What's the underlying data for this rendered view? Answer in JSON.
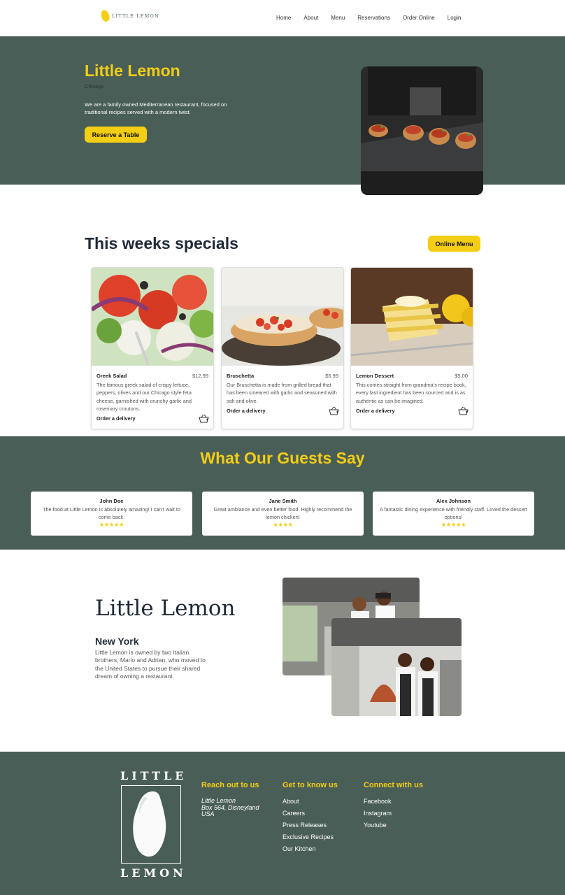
{
  "brand": {
    "logo_text": "LITTLE LEMON",
    "accent": "#F4CE14",
    "primary": "#495E57"
  },
  "nav": {
    "links": [
      "Home",
      "About",
      "Menu",
      "Reservations",
      "Order Online",
      "Login"
    ]
  },
  "hero": {
    "title": "Little Lemon",
    "city": "Chicago",
    "description": "We are a family owned Mediterranean restaurant, focused on traditional recipes served with a modern twist.",
    "cta": "Reserve a Table"
  },
  "specials": {
    "title": "This weeks specials",
    "menu_button": "Online Menu",
    "items": [
      {
        "name": "Greek Salad",
        "price": "$12.99",
        "description": "The famous greek salad of crispy lettuce, peppers, olives and our Chicago style feta cheese, garnished with crunchy garlic and rosemary croutons.",
        "order": "Order a delivery"
      },
      {
        "name": "Bruschetta",
        "price": "$5.99",
        "description": "Our Bruschetta is made from grilled bread that has been smeared with garlic and seasoned with salt and olive.",
        "order": "Order a delivery"
      },
      {
        "name": "Lemon Dessert",
        "price": "$5.00",
        "description": "This comes straight from grandma’s recipe book, every last ingredient has been sourced and is as authentic as can be imagined.",
        "order": "Order a delivery"
      }
    ]
  },
  "testimonials": {
    "title": "What Our Guests Say",
    "items": [
      {
        "name": "John Doe",
        "text": "The food at Little Lemon is absolutely amazing! I can't wait to come back.",
        "stars": "★★★★★",
        "rating": 5
      },
      {
        "name": "Jane Smith",
        "text": "Great ambiance and even better food. Highly recommend the lemon chicken!",
        "stars": "★★★★",
        "rating": 4
      },
      {
        "name": "Alex Johnson",
        "text": "A fantastic dining experience with friendly staff. Loved the dessert options!",
        "stars": "★★★★★",
        "rating": 5
      }
    ]
  },
  "about": {
    "title": "Little Lemon",
    "subtitle": "New York",
    "text": "Little Lemon is owned by two Italian brothers, Mario and Adrian, who moved to the United States to pursue their shared dream of owning a restaurant."
  },
  "footer": {
    "logo_top": "LITTLE",
    "logo_bottom": "LEMON",
    "contact": {
      "heading": "Reach out to us",
      "address": [
        "Little Lemon",
        "Box 564, Disneyland",
        "USA"
      ]
    },
    "know": {
      "heading": "Get to know us",
      "links": [
        "About",
        "Careers",
        "Press Releases",
        "Exclusive Recipes",
        "Our Kitchen"
      ]
    },
    "social": {
      "heading": "Connect with us",
      "links": [
        "Facebook",
        "Instagram",
        "Youtube"
      ]
    }
  }
}
